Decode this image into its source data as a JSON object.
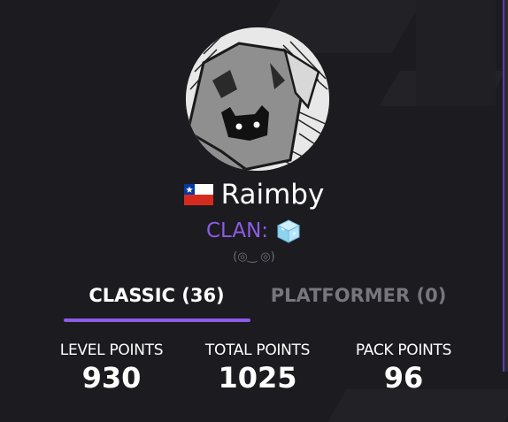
{
  "profile": {
    "username": "Raimby",
    "flag": "chile-flag-icon",
    "clan_label": "CLAN:",
    "clan_icon": "ice-cube-icon",
    "subtitle": "(◎‿ ◎)"
  },
  "tabs": [
    {
      "label": "CLASSIC (36)",
      "active": true
    },
    {
      "label": "PLATFORMER (0)",
      "active": false
    }
  ],
  "stats": [
    {
      "label": "LEVEL POINTS",
      "value": "930"
    },
    {
      "label": "TOTAL POINTS",
      "value": "1025"
    },
    {
      "label": "PACK POINTS",
      "value": "96"
    }
  ],
  "colors": {
    "background": "#1c1b20",
    "accent": "#8c5ce6",
    "inactive_tab": "#77767d",
    "text": "#ffffff"
  }
}
